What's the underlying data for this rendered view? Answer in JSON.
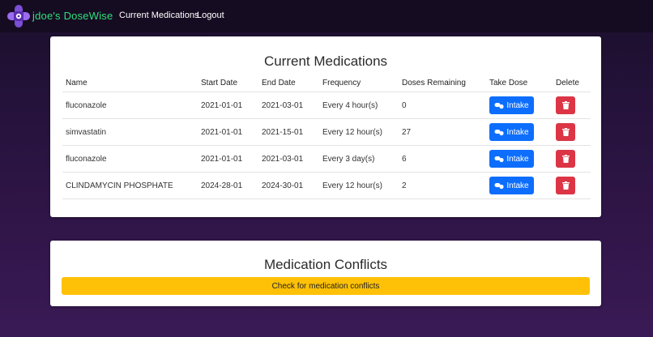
{
  "navbar": {
    "brand": "jdoe's DoseWise",
    "links": [
      "Current Medications",
      "Logout"
    ]
  },
  "medications_card": {
    "title": "Current Medications",
    "columns": [
      "Name",
      "Start Date",
      "End Date",
      "Frequency",
      "Doses Remaining",
      "Take Dose",
      "Delete"
    ],
    "rows": [
      {
        "name": "fluconazole",
        "start": "2021-01-01",
        "end": "2021-03-01",
        "frequency": "Every 4 hour(s)",
        "remaining": "0"
      },
      {
        "name": "simvastatin",
        "start": "2021-01-01",
        "end": "2021-15-01",
        "frequency": "Every 12 hour(s)",
        "remaining": "27"
      },
      {
        "name": "fluconazole",
        "start": "2021-01-01",
        "end": "2021-03-01",
        "frequency": "Every 3 day(s)",
        "remaining": "6"
      },
      {
        "name": "CLINDAMYCIN PHOSPHATE",
        "start": "2024-28-01",
        "end": "2024-30-01",
        "frequency": "Every 12 hour(s)",
        "remaining": "2"
      }
    ],
    "intake_label": "Intake"
  },
  "conflicts_card": {
    "title": "Medication Conflicts",
    "button_label": "Check for medication conflicts"
  },
  "colors": {
    "brand": "#2ee07a",
    "intake": "#0d6efd",
    "delete": "#dc3545",
    "conflicts_button": "#ffc107"
  },
  "icons": [
    "logo-pill-icon",
    "pills-icon",
    "trash-icon"
  ]
}
